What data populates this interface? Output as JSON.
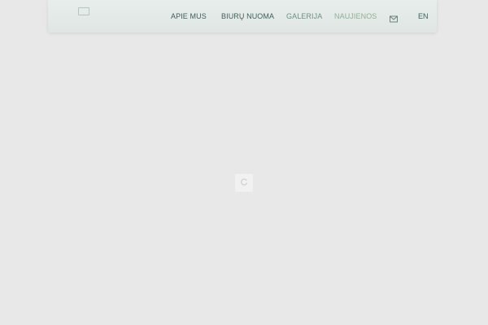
{
  "header": {
    "logo_icon": "logo-icon",
    "nav": [
      {
        "label": "APIE MUS"
      },
      {
        "label": "BIURŲ NUOMA"
      },
      {
        "label": "GALERIJA"
      },
      {
        "label": "NAUJIENOS"
      }
    ],
    "mail_icon": "mail-icon",
    "language": "EN"
  },
  "loader": {
    "icon": "spinner-icon"
  },
  "colors": {
    "background": "#e8e8e8",
    "header_bg": "#e3eae8",
    "nav_text": "#3e5f57",
    "nav_text_muted": "#6d8f84",
    "nav_text_accent": "#8fae93"
  }
}
